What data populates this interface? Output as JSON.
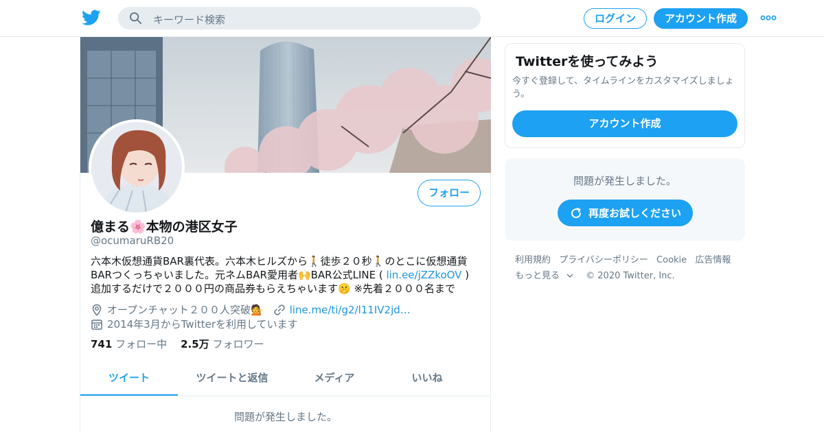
{
  "nav": {
    "search_placeholder": "キーワード検索",
    "login": "ログイン",
    "signup": "アカウント作成"
  },
  "profile": {
    "name": "億まる🌸本物の港区女子",
    "handle": "@ocumaruRB20",
    "follow": "フォロー",
    "bio_1": "六本木仮想通貨BAR裏代表。六本木ヒルズから🚶徒歩２０秒🚶のとこに仮想通貨BARつくっちゃいました。元ネムBAR愛用者🙌BAR公式LINE ( ",
    "bio_link": "lin.ee/jZZkoOV",
    "bio_2": " ) 追加するだけで２０００円の商品券もらえちゃいます🤫 ※先着２０００名まで",
    "location": "オープンチャット２００人突破💁",
    "url": "line.me/ti/g2/l11IV2jd…",
    "joined": "2014年3月からTwitterを利用しています",
    "following_count": "741",
    "following_label": "フォロー中",
    "followers_count": "2.5万",
    "followers_label": "フォロワー"
  },
  "tabs": [
    "ツイート",
    "ツイートと返信",
    "メディア",
    "いいね"
  ],
  "timeline_error": "問題が発生しました。",
  "signup_card": {
    "title": "Twitterを使ってみよう",
    "text": "今すぐ登録して、タイムラインをカスタマイズしましょう。",
    "button": "アカウント作成"
  },
  "error_card": {
    "message": "問題が発生しました。",
    "retry": "再度お試しください"
  },
  "footer": {
    "links": [
      "利用規約",
      "プライバシーポリシー",
      "Cookie",
      "広告情報"
    ],
    "more": "もっと見る",
    "copyright": "© 2020 Twitter, Inc."
  },
  "colors": {
    "accent": "#1da1f2",
    "secondary_text": "#657786"
  }
}
